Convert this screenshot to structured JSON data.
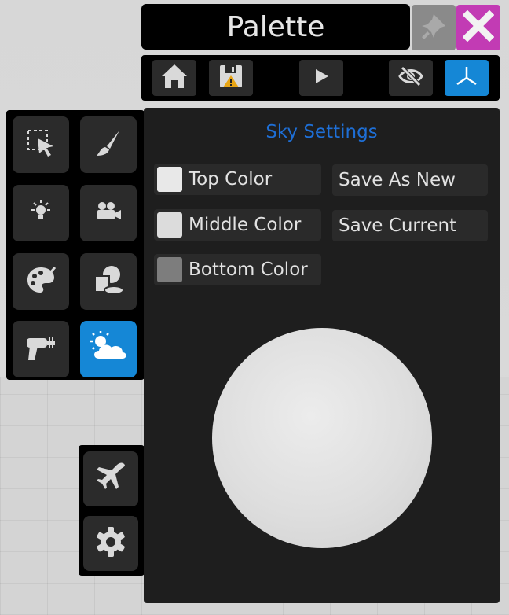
{
  "window": {
    "title": "Palette"
  },
  "title_buttons": {
    "pin_icon": "pin-icon",
    "close_icon": "close-icon",
    "close_color": "#c23bb4",
    "pin_color": "#8a8a8a"
  },
  "toolbar": {
    "buttons": [
      {
        "icon": "home-icon",
        "active": false
      },
      {
        "icon": "save-icon",
        "active": false
      },
      {
        "icon": "play-icon",
        "active": false
      },
      {
        "icon": "eye-off-icon",
        "active": false
      },
      {
        "icon": "axes-icon",
        "active": true
      }
    ],
    "accent": "#1587d6"
  },
  "left_tools": [
    {
      "icon": "select-icon",
      "active": false
    },
    {
      "icon": "brush-icon",
      "active": false
    },
    {
      "icon": "light-icon",
      "active": false
    },
    {
      "icon": "camera-icon",
      "active": false
    },
    {
      "icon": "palette-icon",
      "active": false
    },
    {
      "icon": "shapes-icon",
      "active": false
    },
    {
      "icon": "ray-gun-icon",
      "active": false
    },
    {
      "icon": "weather-icon",
      "active": true
    }
  ],
  "bottom_tools": [
    {
      "icon": "airplane-icon"
    },
    {
      "icon": "gear-icon"
    }
  ],
  "sky": {
    "title": "Sky Settings",
    "title_color": "#1e6fd6",
    "rows": [
      {
        "label": "Top Color",
        "swatch": "#e8e8e8"
      },
      {
        "label": "Middle Color",
        "swatch": "#dcdcdc"
      },
      {
        "label": "Bottom Color",
        "swatch": "#7d7d7d"
      }
    ],
    "actions": {
      "save_as_new": "Save As New",
      "save_current": "Save Current"
    }
  }
}
